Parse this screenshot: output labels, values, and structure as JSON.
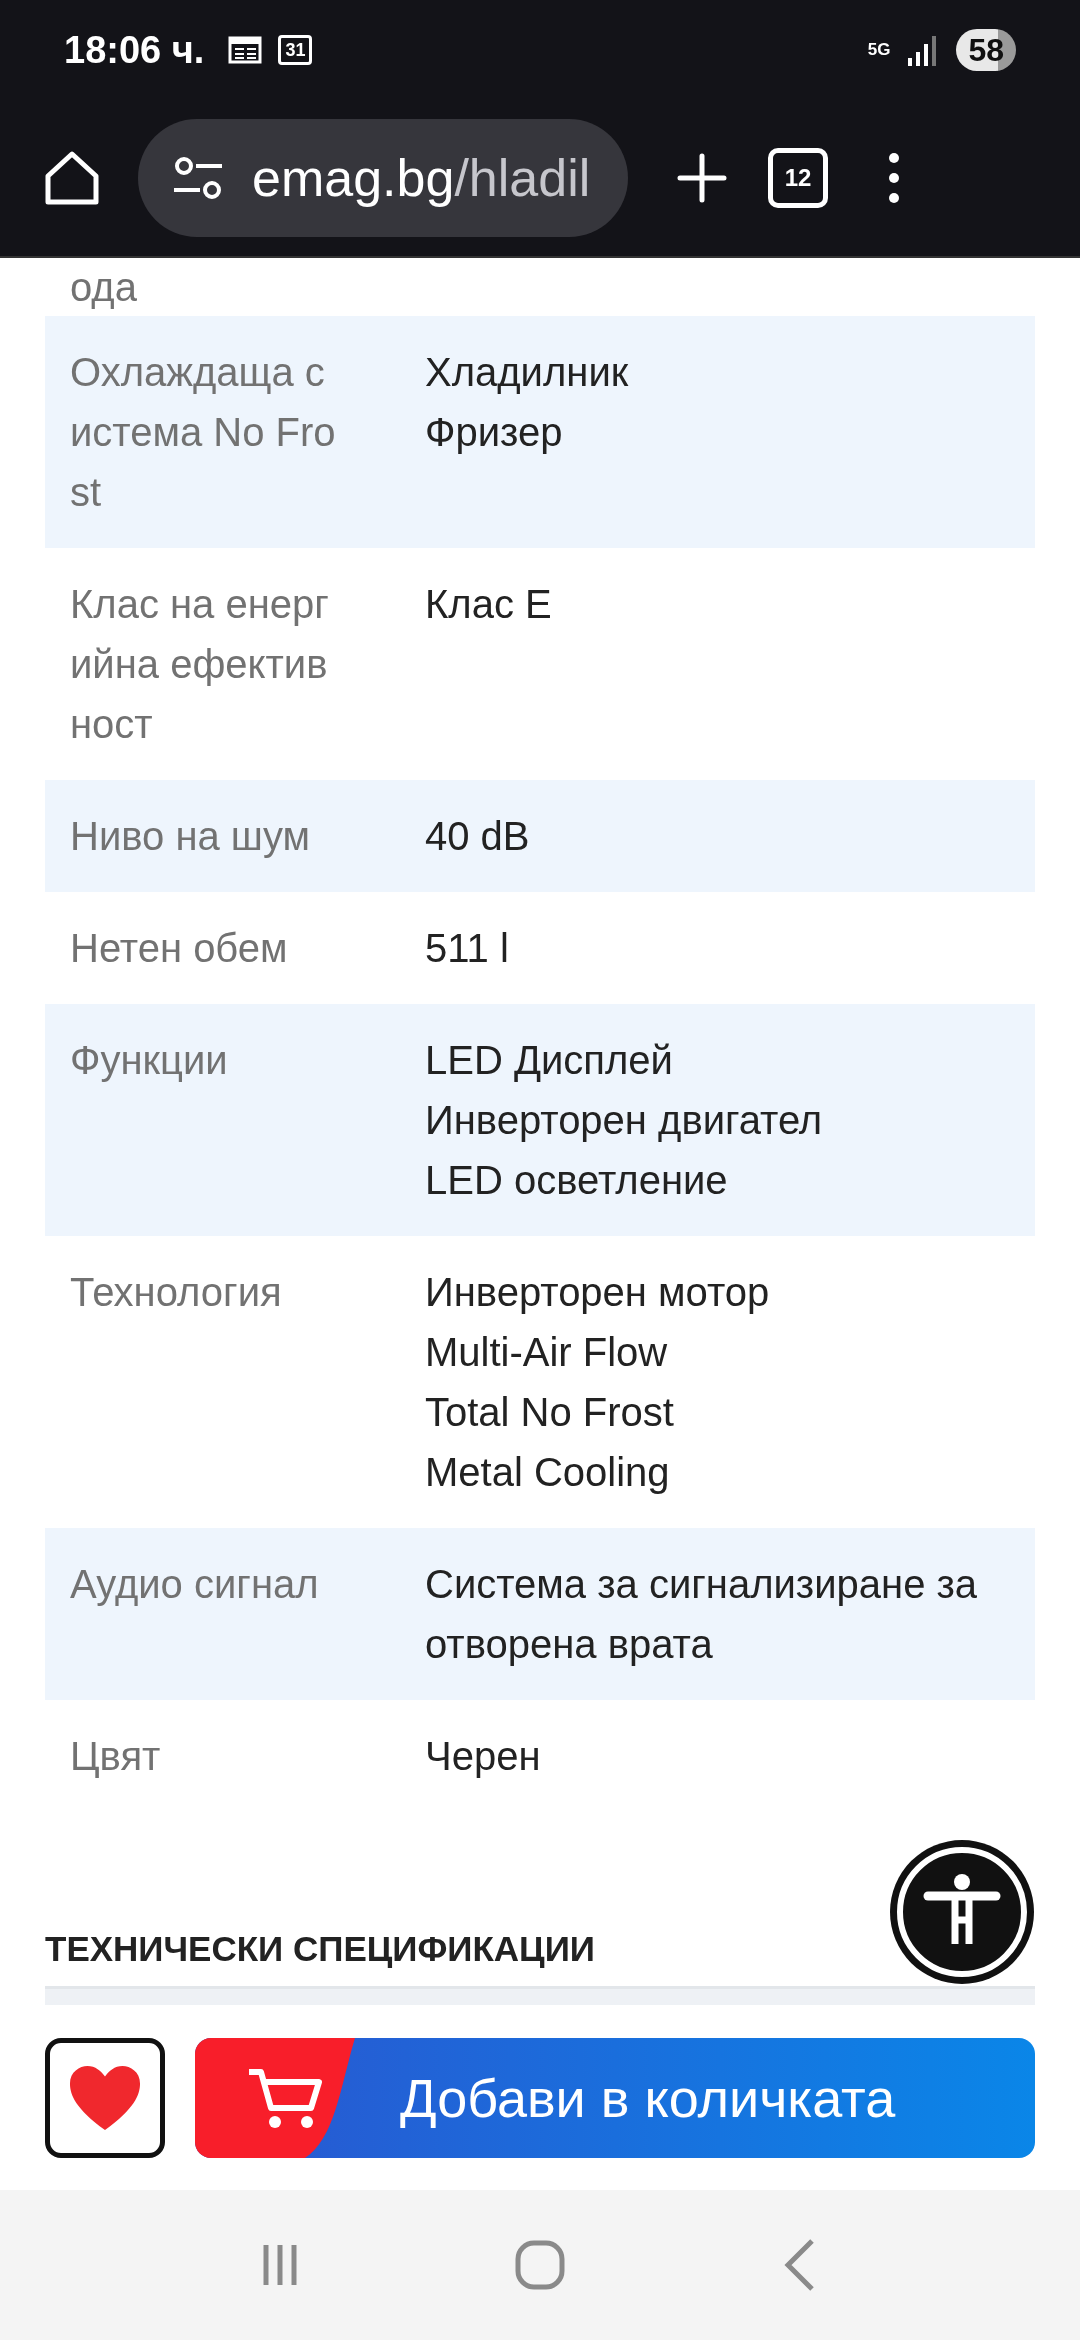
{
  "status_bar": {
    "time": "18:06 ч.",
    "calendar_date": "31",
    "network": "5G",
    "battery": "58"
  },
  "browser": {
    "url_domain": "emag.bg",
    "url_path": "/hladil",
    "tab_count": "12"
  },
  "specs": {
    "partial_label": "ода",
    "rows": [
      {
        "label": "Охлаждаща система No Frost",
        "values": [
          "Хладилник",
          "Фризер"
        ]
      },
      {
        "label": "Клас на енергийна ефективност",
        "values": [
          "Клас E"
        ]
      },
      {
        "label": "Ниво на шум",
        "values": [
          "40 dB"
        ]
      },
      {
        "label": "Нетен обем",
        "values": [
          "511 l"
        ]
      },
      {
        "label": "Функции",
        "values": [
          "LED Дисплей",
          "Инверторен двигател",
          "LED осветление"
        ]
      },
      {
        "label": "Технология",
        "values": [
          "Инверторен мотор",
          "Multi-Air Flow",
          "Total No Frost",
          "Metal Cooling"
        ]
      },
      {
        "label": "Аудио сигнал",
        "values": [
          "Система за сигнализиране за отворена врата"
        ]
      },
      {
        "label": "Цвят",
        "values": [
          "Черен"
        ]
      }
    ]
  },
  "section_heading": "ТЕХНИЧЕСКИ СПЕЦИФИКАЦИИ",
  "bottom_bar": {
    "add_to_cart": "Добави в количката"
  }
}
